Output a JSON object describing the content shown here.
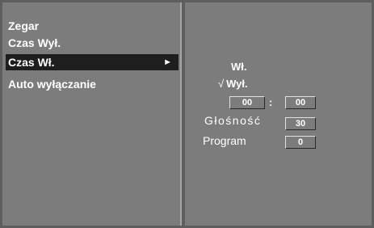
{
  "menu": {
    "items": [
      {
        "label": "Zegar"
      },
      {
        "label": "Czas Wył."
      },
      {
        "label": "Czas Wł.",
        "arrow": "►"
      },
      {
        "label": "Auto wyłączanie"
      }
    ],
    "selected_index": 2
  },
  "submenu": {
    "option_on": "Wł.",
    "option_off": "Wył.",
    "check_mark": "√",
    "hour": "00",
    "time_separator": ":",
    "minute": "00",
    "volume_label": "Głośność",
    "volume_value": "30",
    "program_label": "Program",
    "program_value": "0"
  },
  "colors": {
    "panel_bg": "#7c7c7c",
    "frame_bg": "#5e5e5e",
    "selection_bg": "#1e1e1e",
    "text": "#ffffff"
  },
  "icons": {
    "submenu_arrow": "arrow-right-icon",
    "check": "check-icon"
  }
}
